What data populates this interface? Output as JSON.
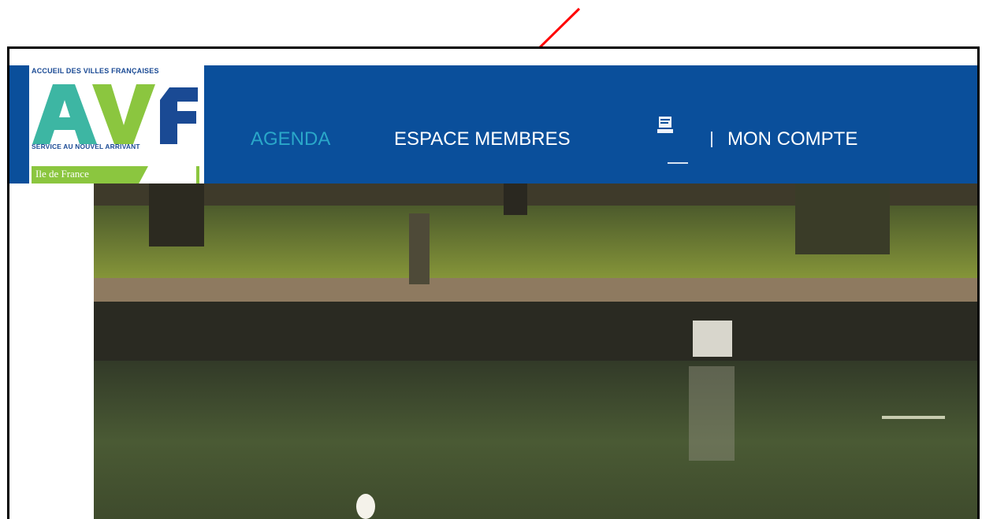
{
  "logo": {
    "top_text": "ACCUEIL DES VILLES FRANÇAISES",
    "letters": "AVf",
    "bottom_text": "SERVICE AU NOUVEL ARRIVANT",
    "region": "Ile de France"
  },
  "nav": {
    "items": [
      {
        "label": "AGENDA",
        "state": "active"
      },
      {
        "label": "ESPACE MEMBRES",
        "state": "normal"
      },
      {
        "label": "MON COMPTE",
        "state": "normal"
      }
    ],
    "icon": "cart-icon"
  },
  "colors": {
    "nav_background": "#0a4f9b",
    "active_item": "#2aa7c9",
    "logo_blue": "#1a4a94",
    "logo_green": "#8bc63f",
    "annotation_arrow": "#ff0000"
  },
  "hero": {
    "image": "park-pond-photo"
  }
}
